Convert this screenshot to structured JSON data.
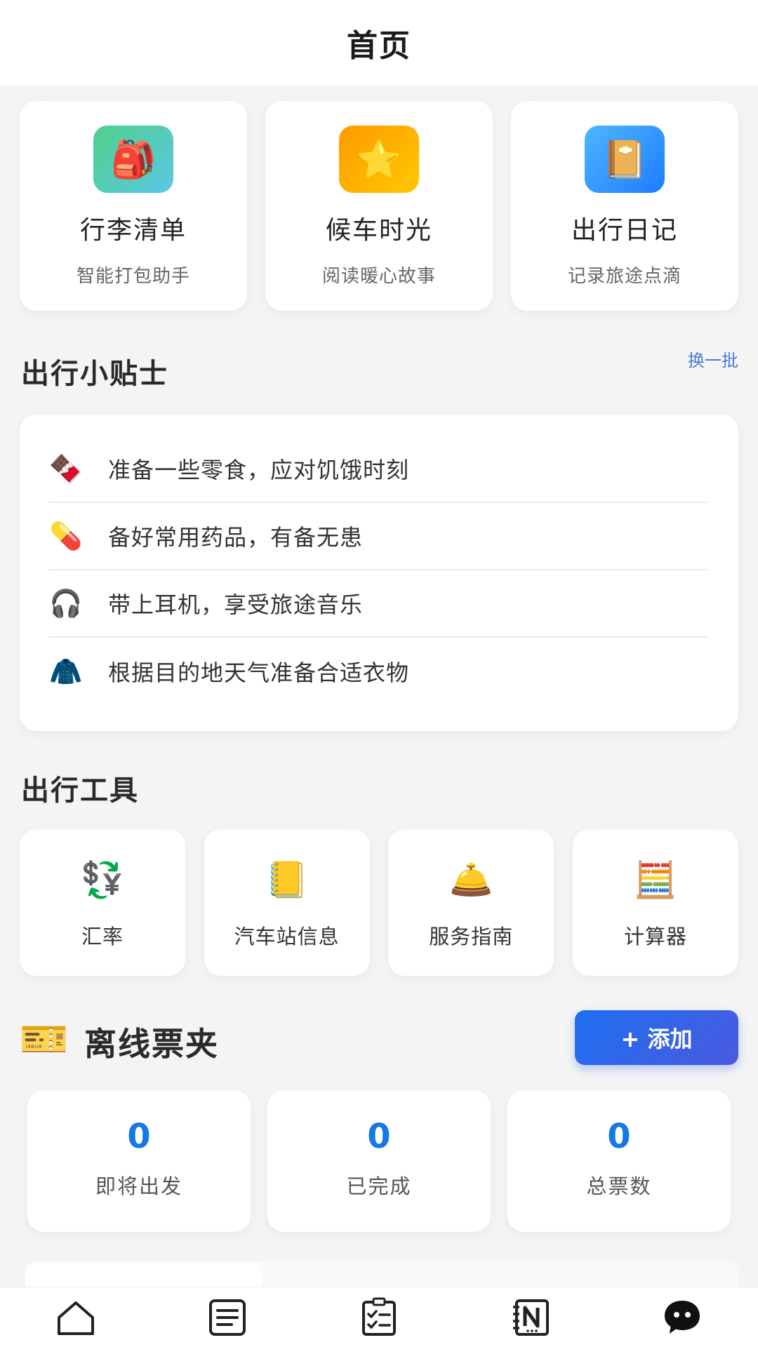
{
  "header": {
    "title": "首页"
  },
  "features": [
    {
      "icon": "backpack-icon",
      "glyph": "🎒",
      "name": "行李清单",
      "desc": "智能打包助手"
    },
    {
      "icon": "star-icon",
      "glyph": "⭐",
      "name": "候车时光",
      "desc": "阅读暖心故事"
    },
    {
      "icon": "journal-icon",
      "glyph": "📔",
      "name": "出行日记",
      "desc": "记录旅途点滴"
    }
  ],
  "tips_section": {
    "title": "出行小贴士",
    "refresh_label": "换一批",
    "items": [
      {
        "icon": "chocolate-icon",
        "glyph": "🍫",
        "text": "准备一些零食，应对饥饿时刻"
      },
      {
        "icon": "pill-icon",
        "glyph": "💊",
        "text": "备好常用药品，有备无患"
      },
      {
        "icon": "headphones-icon",
        "glyph": "🎧",
        "text": "带上耳机，享受旅途音乐"
      },
      {
        "icon": "coat-icon",
        "glyph": "🧥",
        "text": "根据目的地天气准备合适衣物"
      }
    ]
  },
  "tools_section": {
    "title": "出行工具",
    "items": [
      {
        "icon": "currency-exchange-icon",
        "glyph": "💱",
        "label": "汇率"
      },
      {
        "icon": "notebook-icon",
        "glyph": "📒",
        "label": "汽车站信息"
      },
      {
        "icon": "service-bell-icon",
        "glyph": "🛎️",
        "label": "服务指南"
      },
      {
        "icon": "abacus-icon",
        "glyph": "🧮",
        "label": "计算器"
      }
    ]
  },
  "wallet": {
    "icon": "ticket-icon",
    "glyph": "🎫",
    "title": "离线票夹",
    "add_label": "+ 添加",
    "stats": [
      {
        "value": "0",
        "label": "即将出发"
      },
      {
        "value": "0",
        "label": "已完成"
      },
      {
        "value": "0",
        "label": "总票数"
      }
    ]
  },
  "colors": {
    "accent": "#1778e8",
    "link": "#4a78d8",
    "button_start": "#1e6ef0",
    "button_end": "#4a5ae0"
  },
  "bottom_nav": [
    {
      "icon": "home-icon"
    },
    {
      "icon": "list-icon"
    },
    {
      "icon": "checklist-icon"
    },
    {
      "icon": "notebook-n-icon"
    },
    {
      "icon": "chat-bot-icon"
    }
  ]
}
